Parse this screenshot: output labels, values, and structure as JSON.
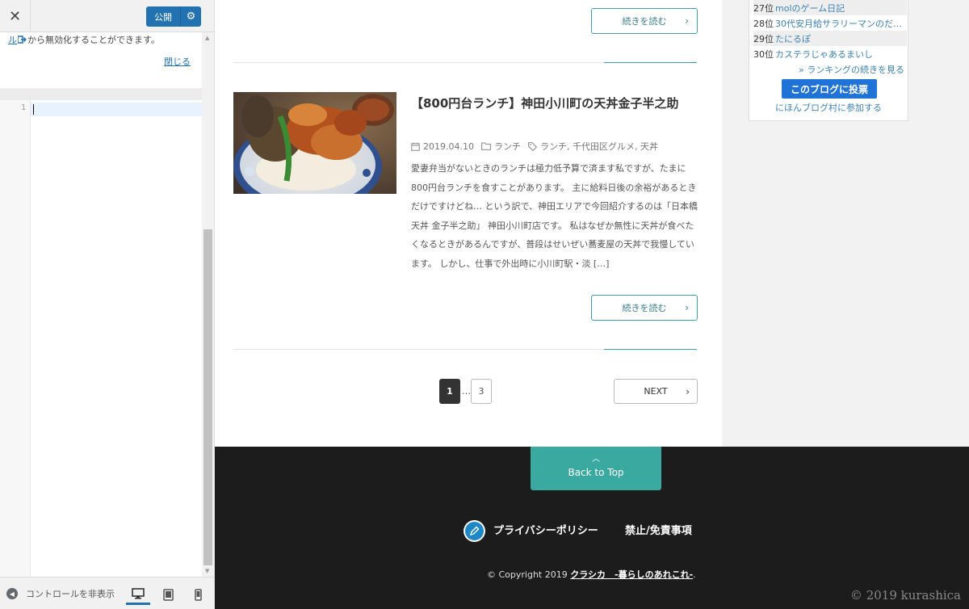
{
  "sidebar": {
    "publish_label": "公開",
    "notice_link": "ル",
    "notice_text": "から無効化することができます。",
    "close_link": "閉じる",
    "line_number": "1",
    "collapse_label": "コントロールを非表示"
  },
  "post": {
    "read_more_label": "続きを読む",
    "title": "【800円台ランチ】神田小川町の天丼金子半之助",
    "date": "2019.04.10",
    "category": "ランチ",
    "tags": "ランチ, 千代田区グルメ, 天丼",
    "excerpt": "愛妻弁当がないときのランチは極力低予算で済ます私ですが、たまに800円台ランチを食すことがあります。 主に給料日後の余裕があるときだけですけどね… という訳で、神田エリアで今回紹介するのは「日本橋 天丼 金子半之助」 神田小川町店です。 私はなぜか無性に天丼が食べたくなるときがあるんですが、普段はせいぜい蕎麦屋の天丼で我慢しています。 しかし、仕事で外出時に小川町駅・淡 […]"
  },
  "pagination": {
    "current": "1",
    "dots": "…",
    "last": "3",
    "next": "NEXT"
  },
  "ranking": {
    "items": [
      {
        "rank": "27位",
        "title": "molのゲーム日記"
      },
      {
        "rank": "28位",
        "title": "30代安月給サラリーマンのだ…"
      },
      {
        "rank": "29位",
        "title": "たにるぽ"
      },
      {
        "rank": "30位",
        "title": "カステラじゃあるまいし"
      }
    ],
    "more_link": "» ランキングの続きを見る",
    "vote_button": "このブログに投票",
    "join_link": "にほんブログ村に参加する"
  },
  "footer": {
    "back_to_top": "Back to Top",
    "privacy_link": "プライバシーポリシー",
    "disclaimer_link": "禁止/免責事項",
    "copyright_prefix": "© Copyright 2019",
    "site_name": "クラシカ　-暮らしのあれこれ-",
    "copyright_suffix": ".",
    "watermark": "© 2019 kurashica"
  },
  "colors": {
    "accent_teal": "#3aa99f",
    "wp_blue": "#2271b1",
    "footer_bg": "#1c1c1c",
    "vote_blue": "#1f73d6"
  }
}
